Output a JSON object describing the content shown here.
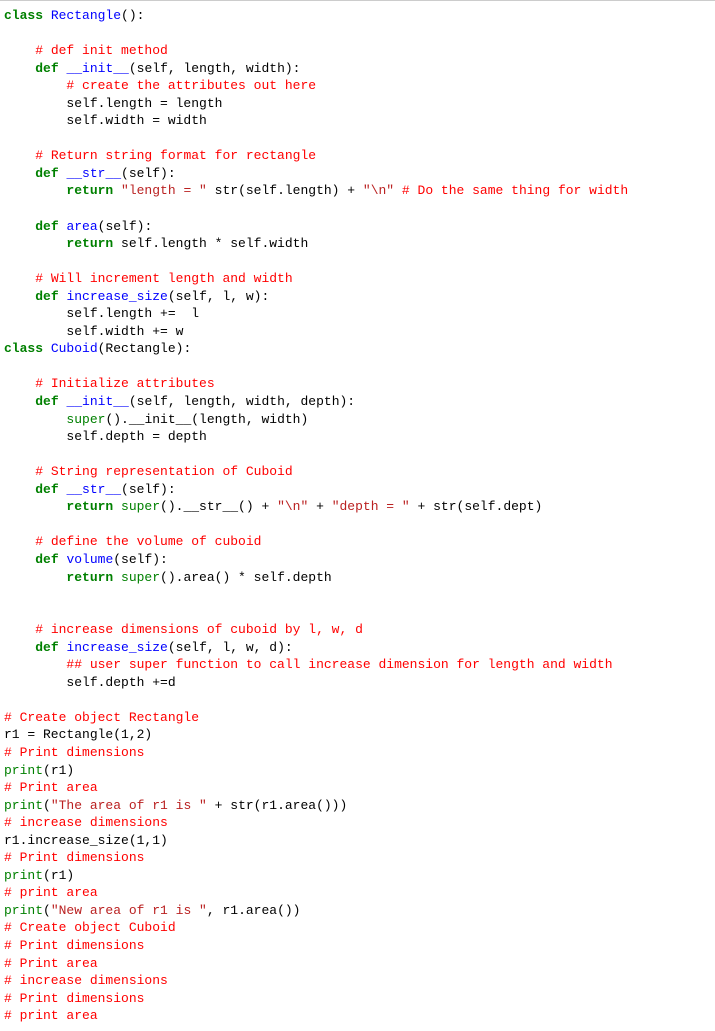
{
  "lines": [
    {
      "tokens": [
        {
          "t": "class ",
          "c": "kw"
        },
        {
          "t": "Rectangle",
          "c": "cls"
        },
        {
          "t": "():"
        }
      ]
    },
    {
      "tokens": [
        {
          "t": ""
        }
      ]
    },
    {
      "tokens": [
        {
          "t": "    "
        },
        {
          "t": "# def init method",
          "c": "comment"
        }
      ]
    },
    {
      "tokens": [
        {
          "t": "    "
        },
        {
          "t": "def ",
          "c": "kw"
        },
        {
          "t": "__init__",
          "c": "meth"
        },
        {
          "t": "(self, length, width):"
        }
      ]
    },
    {
      "tokens": [
        {
          "t": "        "
        },
        {
          "t": "# create the attributes out here",
          "c": "comment"
        }
      ]
    },
    {
      "tokens": [
        {
          "t": "        self.length = length"
        }
      ]
    },
    {
      "tokens": [
        {
          "t": "        self.width = width"
        }
      ]
    },
    {
      "tokens": [
        {
          "t": ""
        }
      ]
    },
    {
      "tokens": [
        {
          "t": "    "
        },
        {
          "t": "# Return string format for rectangle",
          "c": "comment"
        }
      ]
    },
    {
      "tokens": [
        {
          "t": "    "
        },
        {
          "t": "def ",
          "c": "kw"
        },
        {
          "t": "__str__",
          "c": "meth"
        },
        {
          "t": "(self):"
        }
      ]
    },
    {
      "tokens": [
        {
          "t": "        "
        },
        {
          "t": "return ",
          "c": "kw"
        },
        {
          "t": "\"length = \"",
          "c": "str"
        },
        {
          "t": " str(self.length) + "
        },
        {
          "t": "\"\\n\"",
          "c": "str"
        },
        {
          "t": " "
        },
        {
          "t": "# Do the same thing for width",
          "c": "comment"
        }
      ]
    },
    {
      "tokens": [
        {
          "t": ""
        }
      ]
    },
    {
      "tokens": [
        {
          "t": "    "
        },
        {
          "t": "def ",
          "c": "kw"
        },
        {
          "t": "area",
          "c": "meth"
        },
        {
          "t": "(self):"
        }
      ]
    },
    {
      "tokens": [
        {
          "t": "        "
        },
        {
          "t": "return ",
          "c": "kw"
        },
        {
          "t": "self.length * self.width"
        }
      ]
    },
    {
      "tokens": [
        {
          "t": ""
        }
      ]
    },
    {
      "tokens": [
        {
          "t": "    "
        },
        {
          "t": "# Will increment length and width",
          "c": "comment"
        }
      ]
    },
    {
      "tokens": [
        {
          "t": "    "
        },
        {
          "t": "def ",
          "c": "kw"
        },
        {
          "t": "increase_size",
          "c": "meth"
        },
        {
          "t": "(self, l, w):"
        }
      ]
    },
    {
      "tokens": [
        {
          "t": "        self.length +=  l"
        }
      ]
    },
    {
      "tokens": [
        {
          "t": "        self.width += w"
        }
      ]
    },
    {
      "tokens": [
        {
          "t": "class ",
          "c": "kw"
        },
        {
          "t": "Cuboid",
          "c": "cls"
        },
        {
          "t": "(Rectangle):"
        }
      ]
    },
    {
      "tokens": [
        {
          "t": ""
        }
      ]
    },
    {
      "tokens": [
        {
          "t": "    "
        },
        {
          "t": "# Initialize attributes",
          "c": "comment"
        }
      ]
    },
    {
      "tokens": [
        {
          "t": "    "
        },
        {
          "t": "def ",
          "c": "kw"
        },
        {
          "t": "__init__",
          "c": "meth"
        },
        {
          "t": "(self, length, width, depth):"
        }
      ]
    },
    {
      "tokens": [
        {
          "t": "        "
        },
        {
          "t": "super",
          "c": "sup"
        },
        {
          "t": "().__init__(length, width)"
        }
      ]
    },
    {
      "tokens": [
        {
          "t": "        self.depth = depth"
        }
      ]
    },
    {
      "tokens": [
        {
          "t": ""
        }
      ]
    },
    {
      "tokens": [
        {
          "t": "    "
        },
        {
          "t": "# String representation of Cuboid",
          "c": "comment"
        }
      ]
    },
    {
      "tokens": [
        {
          "t": "    "
        },
        {
          "t": "def ",
          "c": "kw"
        },
        {
          "t": "__str__",
          "c": "meth"
        },
        {
          "t": "(self):"
        }
      ]
    },
    {
      "tokens": [
        {
          "t": "        "
        },
        {
          "t": "return ",
          "c": "kw"
        },
        {
          "t": "super",
          "c": "sup"
        },
        {
          "t": "().__str__() + "
        },
        {
          "t": "\"\\n\"",
          "c": "str"
        },
        {
          "t": " + "
        },
        {
          "t": "\"depth = \"",
          "c": "str"
        },
        {
          "t": " + str(self.dept)"
        }
      ]
    },
    {
      "tokens": [
        {
          "t": ""
        }
      ]
    },
    {
      "tokens": [
        {
          "t": "    "
        },
        {
          "t": "# define the volume of cuboid",
          "c": "comment"
        }
      ]
    },
    {
      "tokens": [
        {
          "t": "    "
        },
        {
          "t": "def ",
          "c": "kw"
        },
        {
          "t": "volume",
          "c": "meth"
        },
        {
          "t": "(self):"
        }
      ]
    },
    {
      "tokens": [
        {
          "t": "        "
        },
        {
          "t": "return ",
          "c": "kw"
        },
        {
          "t": "super",
          "c": "sup"
        },
        {
          "t": "().area() * self.depth"
        }
      ]
    },
    {
      "tokens": [
        {
          "t": ""
        }
      ]
    },
    {
      "tokens": [
        {
          "t": ""
        }
      ]
    },
    {
      "tokens": [
        {
          "t": "    "
        },
        {
          "t": "# increase dimensions of cuboid by l, w, d",
          "c": "comment"
        }
      ]
    },
    {
      "tokens": [
        {
          "t": "    "
        },
        {
          "t": "def ",
          "c": "kw"
        },
        {
          "t": "increase_size",
          "c": "meth"
        },
        {
          "t": "(self, l, w, d):"
        }
      ]
    },
    {
      "tokens": [
        {
          "t": "        "
        },
        {
          "t": "## user super function to call increase dimension for length and width",
          "c": "comment"
        }
      ]
    },
    {
      "tokens": [
        {
          "t": "        self.depth +=d"
        }
      ]
    },
    {
      "tokens": [
        {
          "t": ""
        }
      ]
    },
    {
      "tokens": [
        {
          "t": "# Create object Rectangle",
          "c": "comment"
        }
      ]
    },
    {
      "tokens": [
        {
          "t": "r1 = Rectangle(1,2)"
        }
      ]
    },
    {
      "tokens": [
        {
          "t": "# Print dimensions",
          "c": "comment"
        }
      ]
    },
    {
      "tokens": [
        {
          "t": "print",
          "c": "builtin"
        },
        {
          "t": "(r1)"
        }
      ]
    },
    {
      "tokens": [
        {
          "t": "# Print area",
          "c": "comment"
        }
      ]
    },
    {
      "tokens": [
        {
          "t": "print",
          "c": "builtin"
        },
        {
          "t": "("
        },
        {
          "t": "\"The area of r1 is \"",
          "c": "str"
        },
        {
          "t": " + str(r1.area()))"
        }
      ]
    },
    {
      "tokens": [
        {
          "t": "# increase dimensions",
          "c": "comment"
        }
      ]
    },
    {
      "tokens": [
        {
          "t": "r1.increase_size(1,1)"
        }
      ]
    },
    {
      "tokens": [
        {
          "t": "# Print dimensions",
          "c": "comment"
        }
      ]
    },
    {
      "tokens": [
        {
          "t": "print",
          "c": "builtin"
        },
        {
          "t": "(r1)"
        }
      ]
    },
    {
      "tokens": [
        {
          "t": "# print area",
          "c": "comment"
        }
      ]
    },
    {
      "tokens": [
        {
          "t": "print",
          "c": "builtin"
        },
        {
          "t": "("
        },
        {
          "t": "\"New area of r1 is \"",
          "c": "str"
        },
        {
          "t": ", r1.area())"
        }
      ]
    },
    {
      "tokens": [
        {
          "t": "# Create object Cuboid",
          "c": "comment"
        }
      ]
    },
    {
      "tokens": [
        {
          "t": "# Print dimensions",
          "c": "comment"
        }
      ]
    },
    {
      "tokens": [
        {
          "t": "# Print area",
          "c": "comment"
        }
      ]
    },
    {
      "tokens": [
        {
          "t": "# increase dimensions",
          "c": "comment"
        }
      ]
    },
    {
      "tokens": [
        {
          "t": "# Print dimensions",
          "c": "comment"
        }
      ]
    },
    {
      "tokens": [
        {
          "t": "# print area",
          "c": "comment"
        }
      ]
    }
  ]
}
